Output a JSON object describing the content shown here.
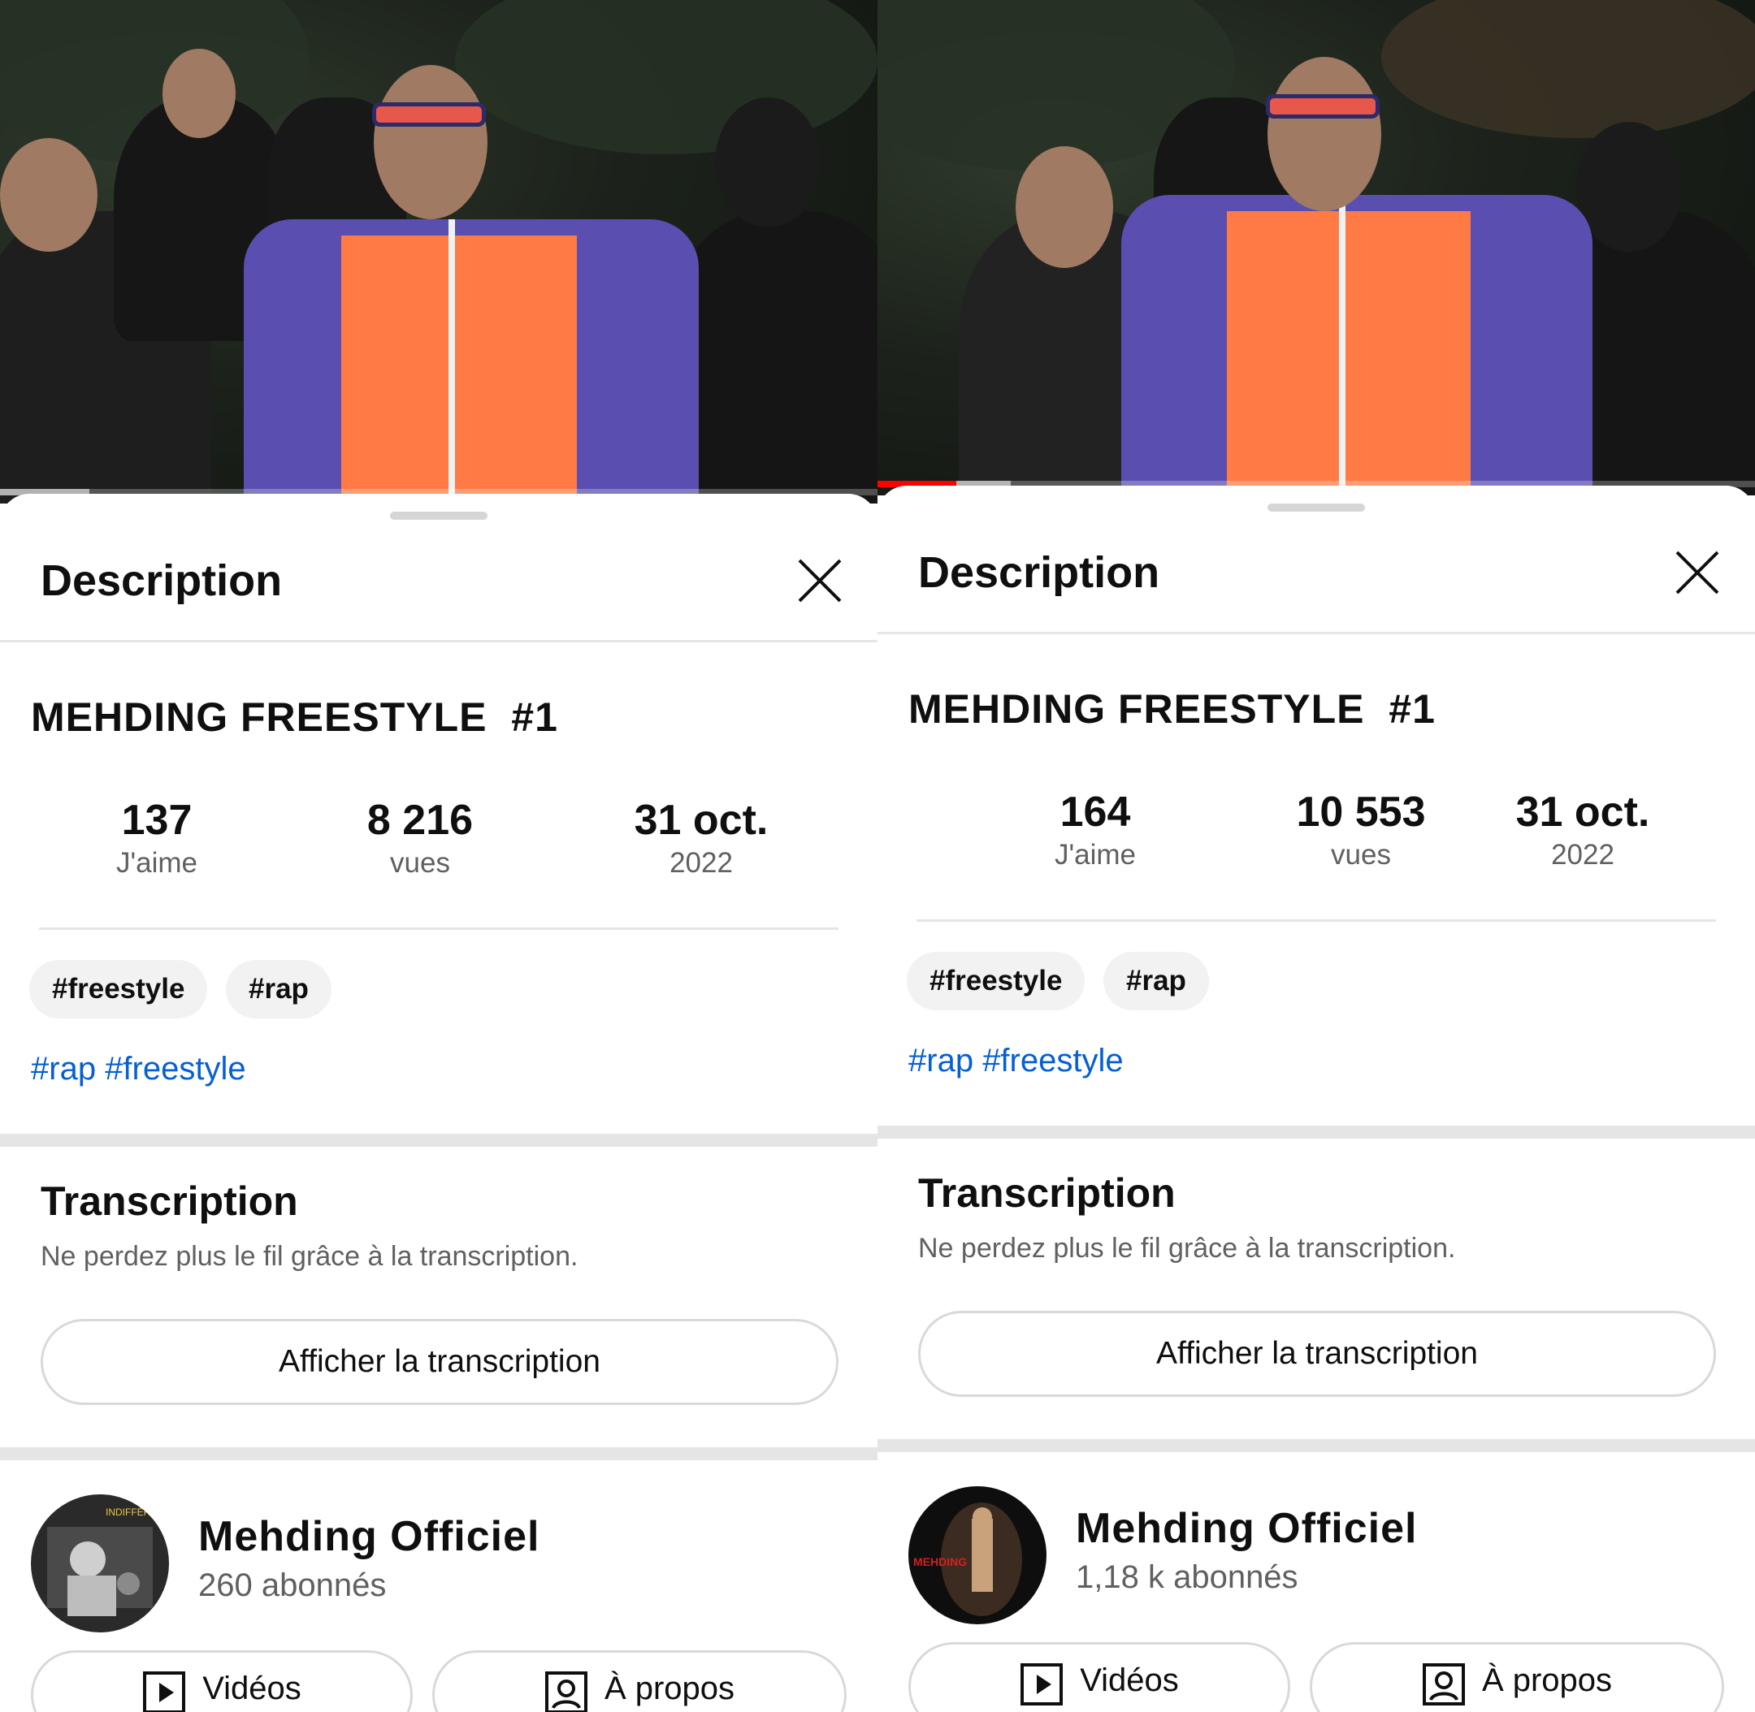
{
  "colors": {
    "link": "#065fd4",
    "progress": "#ff0000",
    "chip_bg": "#f2f2f2",
    "secondary_text": "#606060"
  },
  "panels": [
    {
      "sheet_title": "Description",
      "video_title": "MEHDING FREESTYLE  #1",
      "progress": 0.0,
      "stats": {
        "likes": "137",
        "likes_label": "J'aime",
        "views": "8 216",
        "views_label": "vues",
        "date": "31 oct.",
        "year": "2022"
      },
      "chips": [
        "#freestyle",
        "#rap"
      ],
      "hashtags": [
        "#rap",
        "#freestyle"
      ],
      "transcript": {
        "title": "Transcription",
        "subtitle": "Ne perdez plus le fil grâce à la transcription.",
        "button": "Afficher la transcription"
      },
      "channel": {
        "name": "Mehding Officiel",
        "subscribers": "260 abonnés",
        "avatar_text": "INDIFFÉRENT"
      },
      "actions": {
        "videos": "Vidéos",
        "about": "À propos"
      },
      "icons": [
        "close-icon",
        "play-square-icon",
        "person-square-icon"
      ]
    },
    {
      "sheet_title": "Description",
      "video_title": "MEHDING FREESTYLE  #1",
      "progress": 0.09,
      "stats": {
        "likes": "164",
        "likes_label": "J'aime",
        "views": "10 553",
        "views_label": "vues",
        "date": "31 oct.",
        "year": "2022"
      },
      "chips": [
        "#freestyle",
        "#rap"
      ],
      "hashtags": [
        "#rap",
        "#freestyle"
      ],
      "transcript": {
        "title": "Transcription",
        "subtitle": "Ne perdez plus le fil grâce à la transcription.",
        "button": "Afficher la transcription"
      },
      "channel": {
        "name": "Mehding Officiel",
        "subscribers": "1,18 k abonnés",
        "avatar_text": "MEHDING"
      },
      "actions": {
        "videos": "Vidéos",
        "about": "À propos"
      },
      "icons": [
        "close-icon",
        "play-square-icon",
        "person-square-icon"
      ]
    }
  ]
}
